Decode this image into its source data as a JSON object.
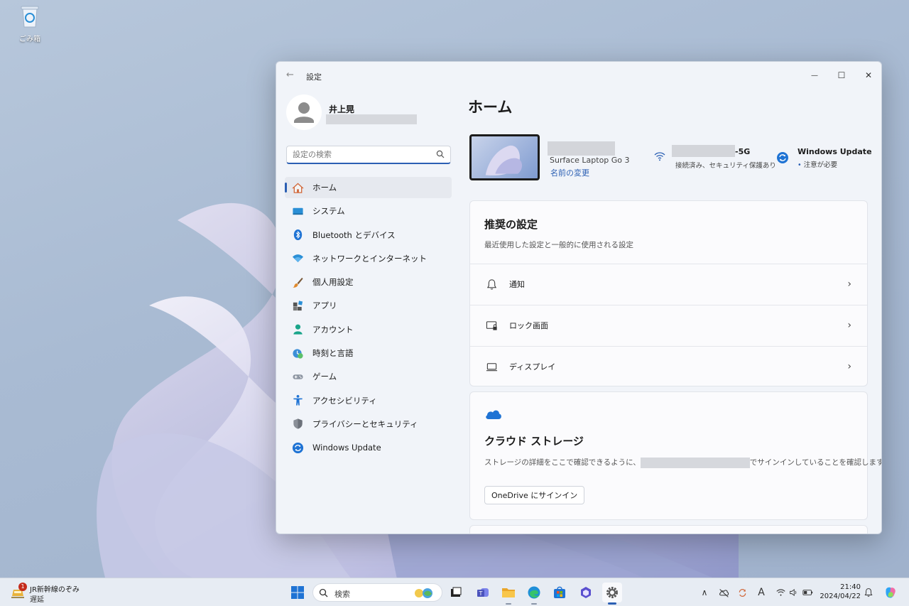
{
  "desktop": {
    "recycle_bin_label": "ごみ箱"
  },
  "window": {
    "title": "設定",
    "controls": {
      "minimize": "—",
      "maximize": "☐",
      "close": "✕"
    }
  },
  "profile": {
    "name": "井上晃"
  },
  "search": {
    "placeholder": "設定の検索"
  },
  "nav": [
    {
      "label": "ホーム",
      "icon": "home-icon",
      "active": true
    },
    {
      "label": "システム",
      "icon": "system-icon"
    },
    {
      "label": "Bluetooth とデバイス",
      "icon": "bluetooth-icon"
    },
    {
      "label": "ネットワークとインターネット",
      "icon": "network-icon"
    },
    {
      "label": "個人用設定",
      "icon": "brush-icon"
    },
    {
      "label": "アプリ",
      "icon": "apps-icon"
    },
    {
      "label": "アカウント",
      "icon": "account-icon"
    },
    {
      "label": "時刻と言語",
      "icon": "time-language-icon"
    },
    {
      "label": "ゲーム",
      "icon": "gamepad-icon"
    },
    {
      "label": "アクセシビリティ",
      "icon": "accessibility-icon"
    },
    {
      "label": "プライバシーとセキュリティ",
      "icon": "shield-icon"
    },
    {
      "label": "Windows Update",
      "icon": "windows-update-icon"
    }
  ],
  "main": {
    "title": "ホーム",
    "device": {
      "model": "Surface Laptop Go 3",
      "rename_link": "名前の変更"
    },
    "wifi": {
      "ssid_suffix": "-5G",
      "status": "接続済み、セキュリティ保護あり"
    },
    "windows_update": {
      "title": "Windows Update",
      "bullet": "•",
      "status": "注意が必要"
    },
    "recommended": {
      "title": "推奨の設定",
      "subtitle": "最近使用した設定と一般的に使用される設定",
      "rows": [
        {
          "label": "通知",
          "icon": "bell-icon"
        },
        {
          "label": "ロック画面",
          "icon": "lock-screen-icon"
        },
        {
          "label": "ディスプレイ",
          "icon": "display-icon"
        }
      ],
      "chevron": "›"
    },
    "cloud": {
      "title": "クラウド ストレージ",
      "description_before": "ストレージの詳細をここで確認できるように、",
      "description_after": "でサインインしていることを確認します。",
      "button": "OneDrive にサインイン"
    }
  },
  "taskbar": {
    "weather": {
      "badge": "1",
      "line1": "JR新幹線のぞみ",
      "line2": "遅延"
    },
    "search_label": "検索",
    "apps": [
      "start-icon",
      "task-view-icon",
      "teams-icon",
      "file-explorer-icon",
      "edge-icon",
      "store-icon",
      "copilot-icon",
      "settings-icon"
    ],
    "tray_chevron": "∧",
    "ime": "A",
    "time": "21:40",
    "date": "2024/04/22"
  },
  "colors": {
    "accent": "#2b5fb3",
    "window_bg": "#f1f4f9",
    "badge": "#c42b1c"
  }
}
